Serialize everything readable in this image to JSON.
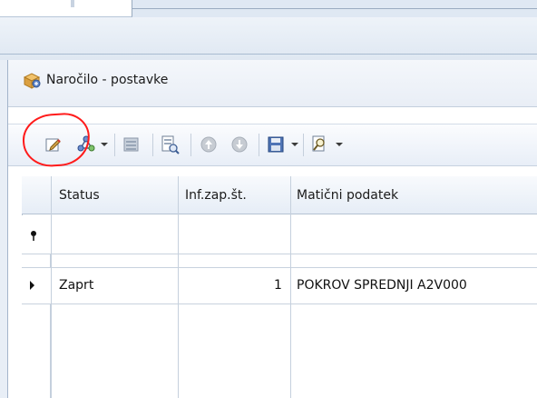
{
  "panel": {
    "title": "Naročilo - postavke"
  },
  "toolbar": {
    "buttons": [
      {
        "name": "edit",
        "icon": "pencil-icon"
      },
      {
        "name": "workflow",
        "icon": "network-icon"
      },
      {
        "name": "list",
        "icon": "list-icon"
      },
      {
        "name": "preview",
        "icon": "document-preview-icon"
      },
      {
        "name": "move-up",
        "icon": "arrow-up-circle-icon"
      },
      {
        "name": "move-down",
        "icon": "arrow-down-circle-icon"
      },
      {
        "name": "save",
        "icon": "floppy-disk-icon"
      },
      {
        "name": "find",
        "icon": "magnifier-icon"
      }
    ]
  },
  "grid": {
    "columns": [
      "Status",
      "Inf.zap.št.",
      "Matični podatek"
    ],
    "rows": [
      {
        "status": "Zaprt",
        "inf_zap_st": "1",
        "maticni_podatek": "POKROV SPREDNJI A2V000"
      }
    ]
  },
  "colors": {
    "highlight": "#ff1b1b",
    "header_bg": "#e6edf6",
    "border": "#b5c2d2"
  }
}
